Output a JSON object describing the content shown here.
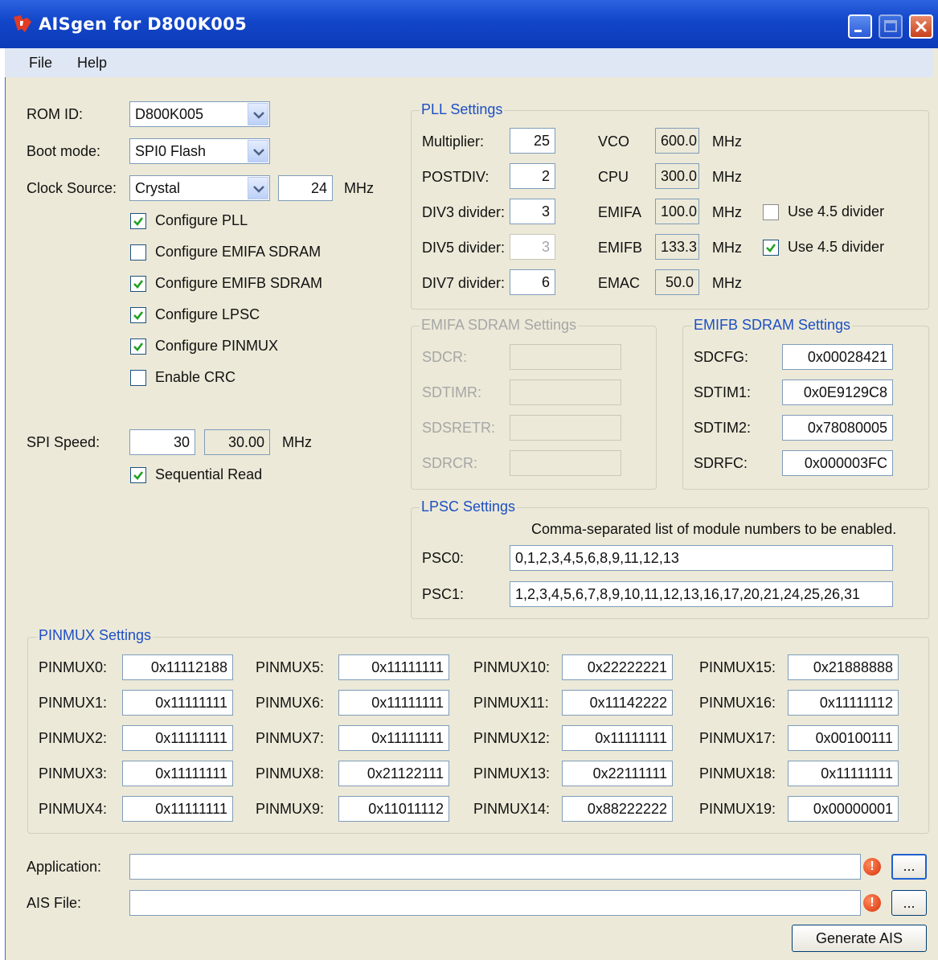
{
  "window": {
    "title": "AISgen for D800K005"
  },
  "menu": {
    "file": "File",
    "help": "Help"
  },
  "left": {
    "rom_id_label": "ROM ID:",
    "rom_id_value": "D800K005",
    "boot_mode_label": "Boot mode:",
    "boot_mode_value": "SPI0 Flash",
    "clock_source_label": "Clock Source:",
    "clock_source_value": "Crystal",
    "clock_mhz_value": "24",
    "clock_mhz_unit": "MHz",
    "configure_pll": "Configure PLL",
    "configure_emifa_sdram": "Configure EMIFA SDRAM",
    "configure_emifb_sdram": "Configure EMIFB SDRAM",
    "configure_lpsc": "Configure LPSC",
    "configure_pinmux": "Configure PINMUX",
    "enable_crc": "Enable CRC",
    "spi_speed_label": "SPI Speed:",
    "spi_speed_value": "30",
    "spi_speed_actual": "30.00",
    "spi_speed_unit": "MHz",
    "sequential_read": "Sequential Read"
  },
  "checks": {
    "configure_pll": true,
    "configure_emifa_sdram": false,
    "configure_emifb_sdram": true,
    "configure_lpsc": true,
    "configure_pinmux": true,
    "enable_crc": false,
    "sequential_read": true,
    "use45_emifa": false,
    "use45_emifb": true
  },
  "pll": {
    "title": "PLL Settings",
    "multiplier_label": "Multiplier:",
    "multiplier": "25",
    "postdiv_label": "POSTDIV:",
    "postdiv": "2",
    "div3_label": "DIV3 divider:",
    "div3": "3",
    "div5_label": "DIV5 divider:",
    "div5": "3",
    "div7_label": "DIV7 divider:",
    "div7": "6",
    "vco_label": "VCO",
    "vco": "600.0",
    "cpu_label": "CPU",
    "cpu": "300.0",
    "emifa_label": "EMIFA",
    "emifa": "100.0",
    "emifb_label": "EMIFB",
    "emifb": "133.3",
    "emac_label": "EMAC",
    "emac": "50.0",
    "unit": "MHz",
    "use45_label": "Use 4.5 divider"
  },
  "emifa": {
    "title": "EMIFA SDRAM Settings",
    "sdcr_label": "SDCR:",
    "sdtimr_label": "SDTIMR:",
    "sdsretr_label": "SDSRETR:",
    "sdrcr_label": "SDRCR:"
  },
  "emifb": {
    "title": "EMIFB SDRAM Settings",
    "sdcfg_label": "SDCFG:",
    "sdcfg": "0x00028421",
    "sdtim1_label": "SDTIM1:",
    "sdtim1": "0x0E9129C8",
    "sdtim2_label": "SDTIM2:",
    "sdtim2": "0x78080005",
    "sdrfc_label": "SDRFC:",
    "sdrfc": "0x000003FC"
  },
  "lpsc": {
    "title": "LPSC Settings",
    "hint": "Comma-separated list of module numbers to be enabled.",
    "psc0_label": "PSC0:",
    "psc0": "0,1,2,3,4,5,6,8,9,11,12,13",
    "psc1_label": "PSC1:",
    "psc1": "1,2,3,4,5,6,7,8,9,10,11,12,13,16,17,20,21,24,25,26,31"
  },
  "pinmux": {
    "title": "PINMUX Settings",
    "items": [
      {
        "label": "PINMUX0:",
        "value": "0x11112188"
      },
      {
        "label": "PINMUX1:",
        "value": "0x11111111"
      },
      {
        "label": "PINMUX2:",
        "value": "0x11111111"
      },
      {
        "label": "PINMUX3:",
        "value": "0x11111111"
      },
      {
        "label": "PINMUX4:",
        "value": "0x11111111"
      },
      {
        "label": "PINMUX5:",
        "value": "0x11111111"
      },
      {
        "label": "PINMUX6:",
        "value": "0x11111111"
      },
      {
        "label": "PINMUX7:",
        "value": "0x11111111"
      },
      {
        "label": "PINMUX8:",
        "value": "0x21122111"
      },
      {
        "label": "PINMUX9:",
        "value": "0x11011112"
      },
      {
        "label": "PINMUX10:",
        "value": "0x22222221"
      },
      {
        "label": "PINMUX11:",
        "value": "0x11142222"
      },
      {
        "label": "PINMUX12:",
        "value": "0x11111111"
      },
      {
        "label": "PINMUX13:",
        "value": "0x22111111"
      },
      {
        "label": "PINMUX14:",
        "value": "0x88222222"
      },
      {
        "label": "PINMUX15:",
        "value": "0x21888888"
      },
      {
        "label": "PINMUX16:",
        "value": "0x11111112"
      },
      {
        "label": "PINMUX17:",
        "value": "0x00100111"
      },
      {
        "label": "PINMUX18:",
        "value": "0x11111111"
      },
      {
        "label": "PINMUX19:",
        "value": "0x00000001"
      }
    ]
  },
  "bottom": {
    "application_label": "Application:",
    "application_value": "",
    "ais_file_label": "AIS File:",
    "ais_file_value": "",
    "browse_label": "...",
    "generate_label": "Generate AIS",
    "error_glyph": "!"
  },
  "colors": {
    "title_bar": "#1245c8",
    "group_title": "#1c4fc4",
    "window_bg": "#ece9d8",
    "error": "#d8310a"
  },
  "icons": {
    "app": "ti-logo-icon",
    "error": "error-icon"
  }
}
